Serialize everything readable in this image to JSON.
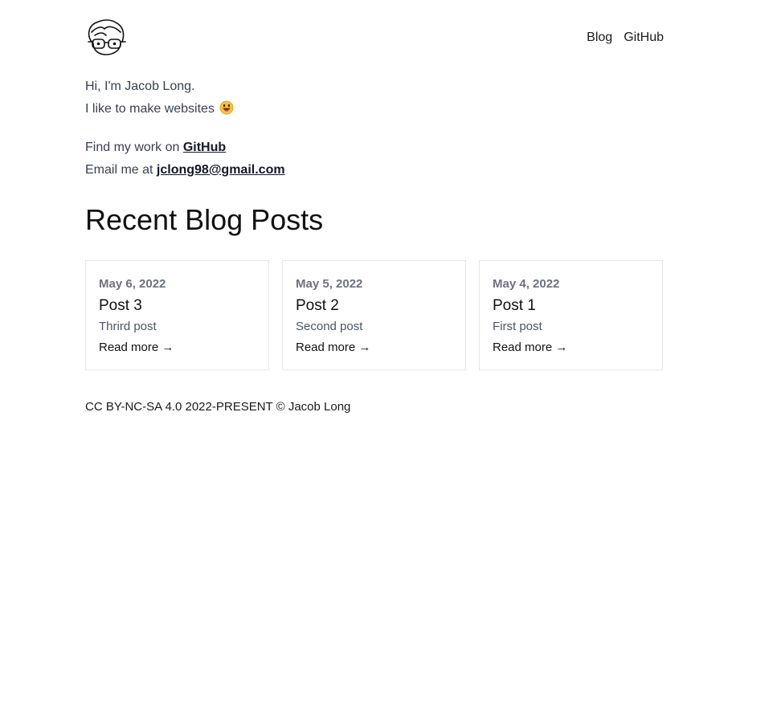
{
  "header": {
    "logo_icon": "avatar-glasses-icon",
    "nav": [
      {
        "label": "Blog"
      },
      {
        "label": "GitHub"
      }
    ]
  },
  "intro": {
    "greeting": "Hi, I'm Jacob Long.",
    "tagline": "I like to make websites",
    "tagline_icon": "smiling-face-emoji-icon"
  },
  "contact": {
    "github_prefix": "Find my work on",
    "github_link": "GitHub",
    "email_prefix": "Email me at",
    "email_link": "jclong98@gmail.com"
  },
  "recent": {
    "title": "Recent Blog Posts",
    "posts": [
      {
        "date": "May 6, 2022",
        "title": "Post 3",
        "description": "Thrird post",
        "read_more": "Read more →"
      },
      {
        "date": "May 5, 2022",
        "title": "Post 2",
        "description": "Second post",
        "read_more": "Read more →"
      },
      {
        "date": "May 4, 2022",
        "title": "Post 1",
        "description": "First post",
        "read_more": "Read more →"
      }
    ]
  },
  "footer": {
    "text": "CC BY-NC-SA 4.0 2022-PRESENT © Jacob Long"
  },
  "colors": {
    "text": "#1a1a1a",
    "muted": "#6b7280",
    "border": "#e5e7eb"
  }
}
